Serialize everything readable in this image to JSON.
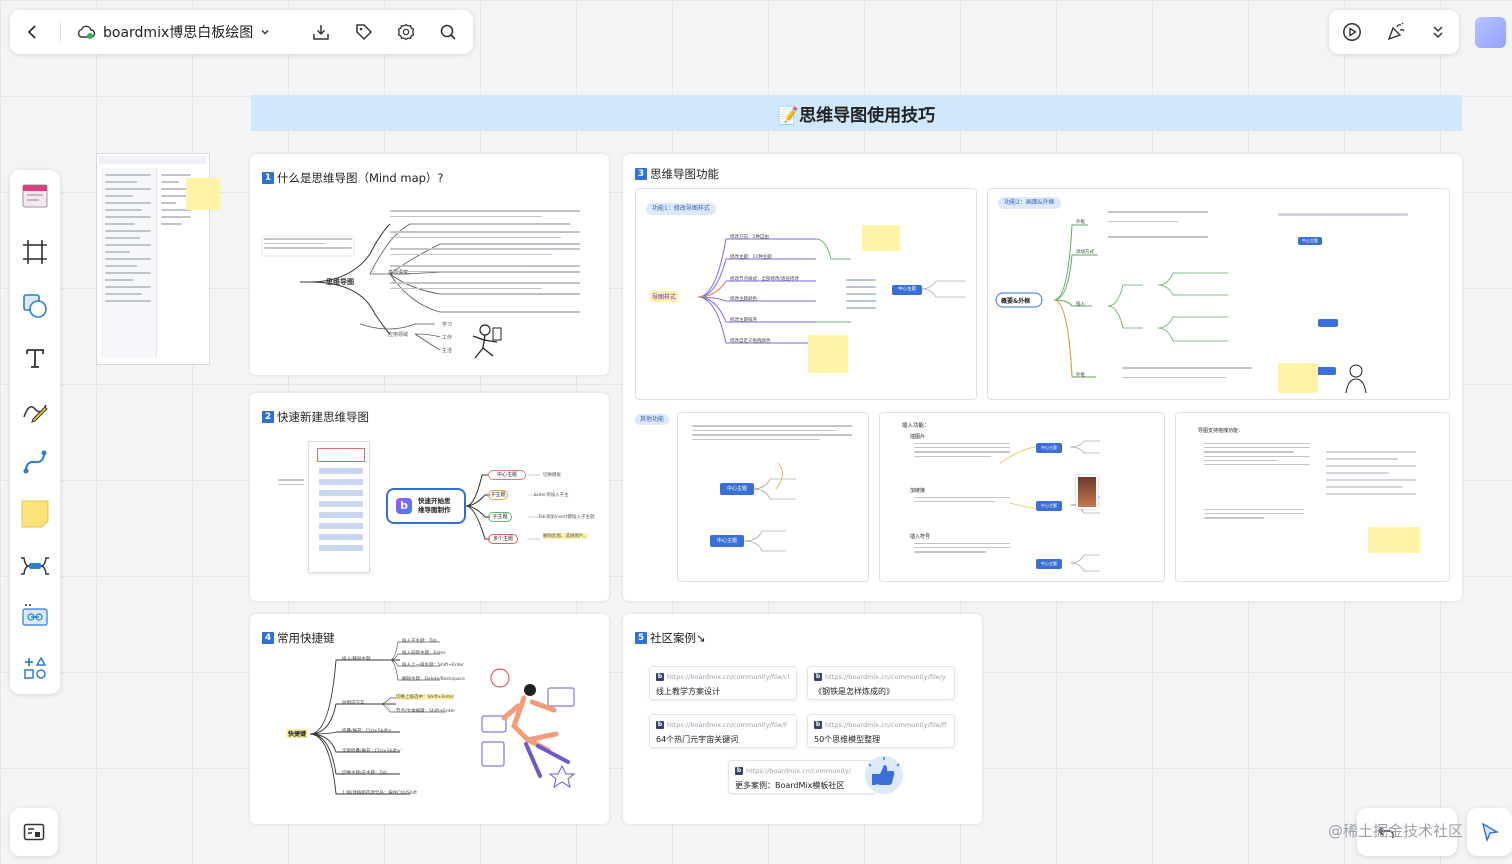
{
  "toolbar": {
    "file_name": "boardmix博思白板绘图"
  },
  "banner": {
    "title": "📝思维导图使用技巧"
  },
  "cards": {
    "what_is": {
      "num": "1",
      "title": "什么是思维导图（Mind map）?"
    },
    "quick_create": {
      "num": "2",
      "title": "快速新建思维导图"
    },
    "functions": {
      "num": "3",
      "title": "思维导图功能"
    },
    "shortcuts": {
      "num": "4",
      "title": "常用快捷键"
    },
    "community": {
      "num": "5",
      "title": "社区案例↘"
    }
  },
  "what_is_map": {
    "center": "思维导图",
    "b1": "基础语意",
    "b2": "应用领域",
    "leaves": [
      "学习",
      "工作",
      "生活"
    ]
  },
  "quick_create_map": {
    "center_line1": "快速开始思",
    "center_line2": "维导图制作",
    "items": [
      "中心主题",
      "子主题",
      "子主题",
      "多个主题"
    ],
    "notes": [
      "切换模板",
      "Enter添加入子主",
      "Tab添加Insert键插入子主题",
      "删除此图、选择图片、"
    ]
  },
  "functions": {
    "sub1_tag": "功能1：修改导图样式",
    "sub1_center": "导图样式",
    "sub1_items": [
      "修改方向：1种自由",
      "修改主题：11种主题",
      "修改节点样式：全部修改/逐层修改",
      "修改主题颜色",
      "修改主题排序",
      "修改自定义拖拽颜色"
    ],
    "sub1_node": "中心主题",
    "sub2_tag": "功能2：画面&外框",
    "sub2_center": "概要&外框",
    "sub2_items": [
      "外框",
      "添加方式",
      "插入",
      "外框"
    ],
    "sub2_node": "中心主题",
    "sub_more_tag": "其他功能",
    "sub3_node1": "中心主题",
    "sub3_node2": "中心主题",
    "sub4_title": "插入功能：",
    "sub4_points": [
      "插图片",
      "加链接",
      "插入符号"
    ],
    "sub4_node1": "中心主题",
    "sub4_node2": "中心主题",
    "sub4_node3": "中心主题",
    "sub5_title": "导图支持拖拽功能："
  },
  "shortcuts_map": {
    "center": "快捷键",
    "branches": [
      "插入/删除主题",
      "导图内交互",
      "折叠/展开：Ctrl+Shift+",
      "全部折叠/展开：Ctrl+Shift+'",
      "切换主题/子主题：Tab",
      "1 缩/放插图选项全局：按住Ctrl/Shift"
    ],
    "subs": [
      "插入子主题：Tab",
      "插入同级主题：Enter",
      "插入上一级主题：Shift+Enter",
      "删除主题：Delete/Backspace",
      "切换上级选中：Shift+Enter",
      "节点/文本编辑：Shift+Enter"
    ]
  },
  "community": {
    "links": [
      {
        "url": "https://boardmix.cn/community/file/cl",
        "text": "线上教学方案设计"
      },
      {
        "url": "https://boardmix.cn/community/file/y",
        "text": "《钢铁是怎样炼成的》"
      },
      {
        "url": "https://boardmix.cn/community/file/F",
        "text": "64个热门元宇宙关键词"
      },
      {
        "url": "https://boardmix.cn/community/file/ff",
        "text": "50个思维模型整理"
      },
      {
        "url": "https://boardmix.cn/community/",
        "text": "更多案例：BoardMix模板社区"
      }
    ]
  },
  "watermark": "@稀土掘金技术社区",
  "colors": {
    "accent": "#2f6fd6",
    "banner": "#cfe8fb",
    "sticky": "#fff3a8",
    "node": "#3b6fd8"
  }
}
